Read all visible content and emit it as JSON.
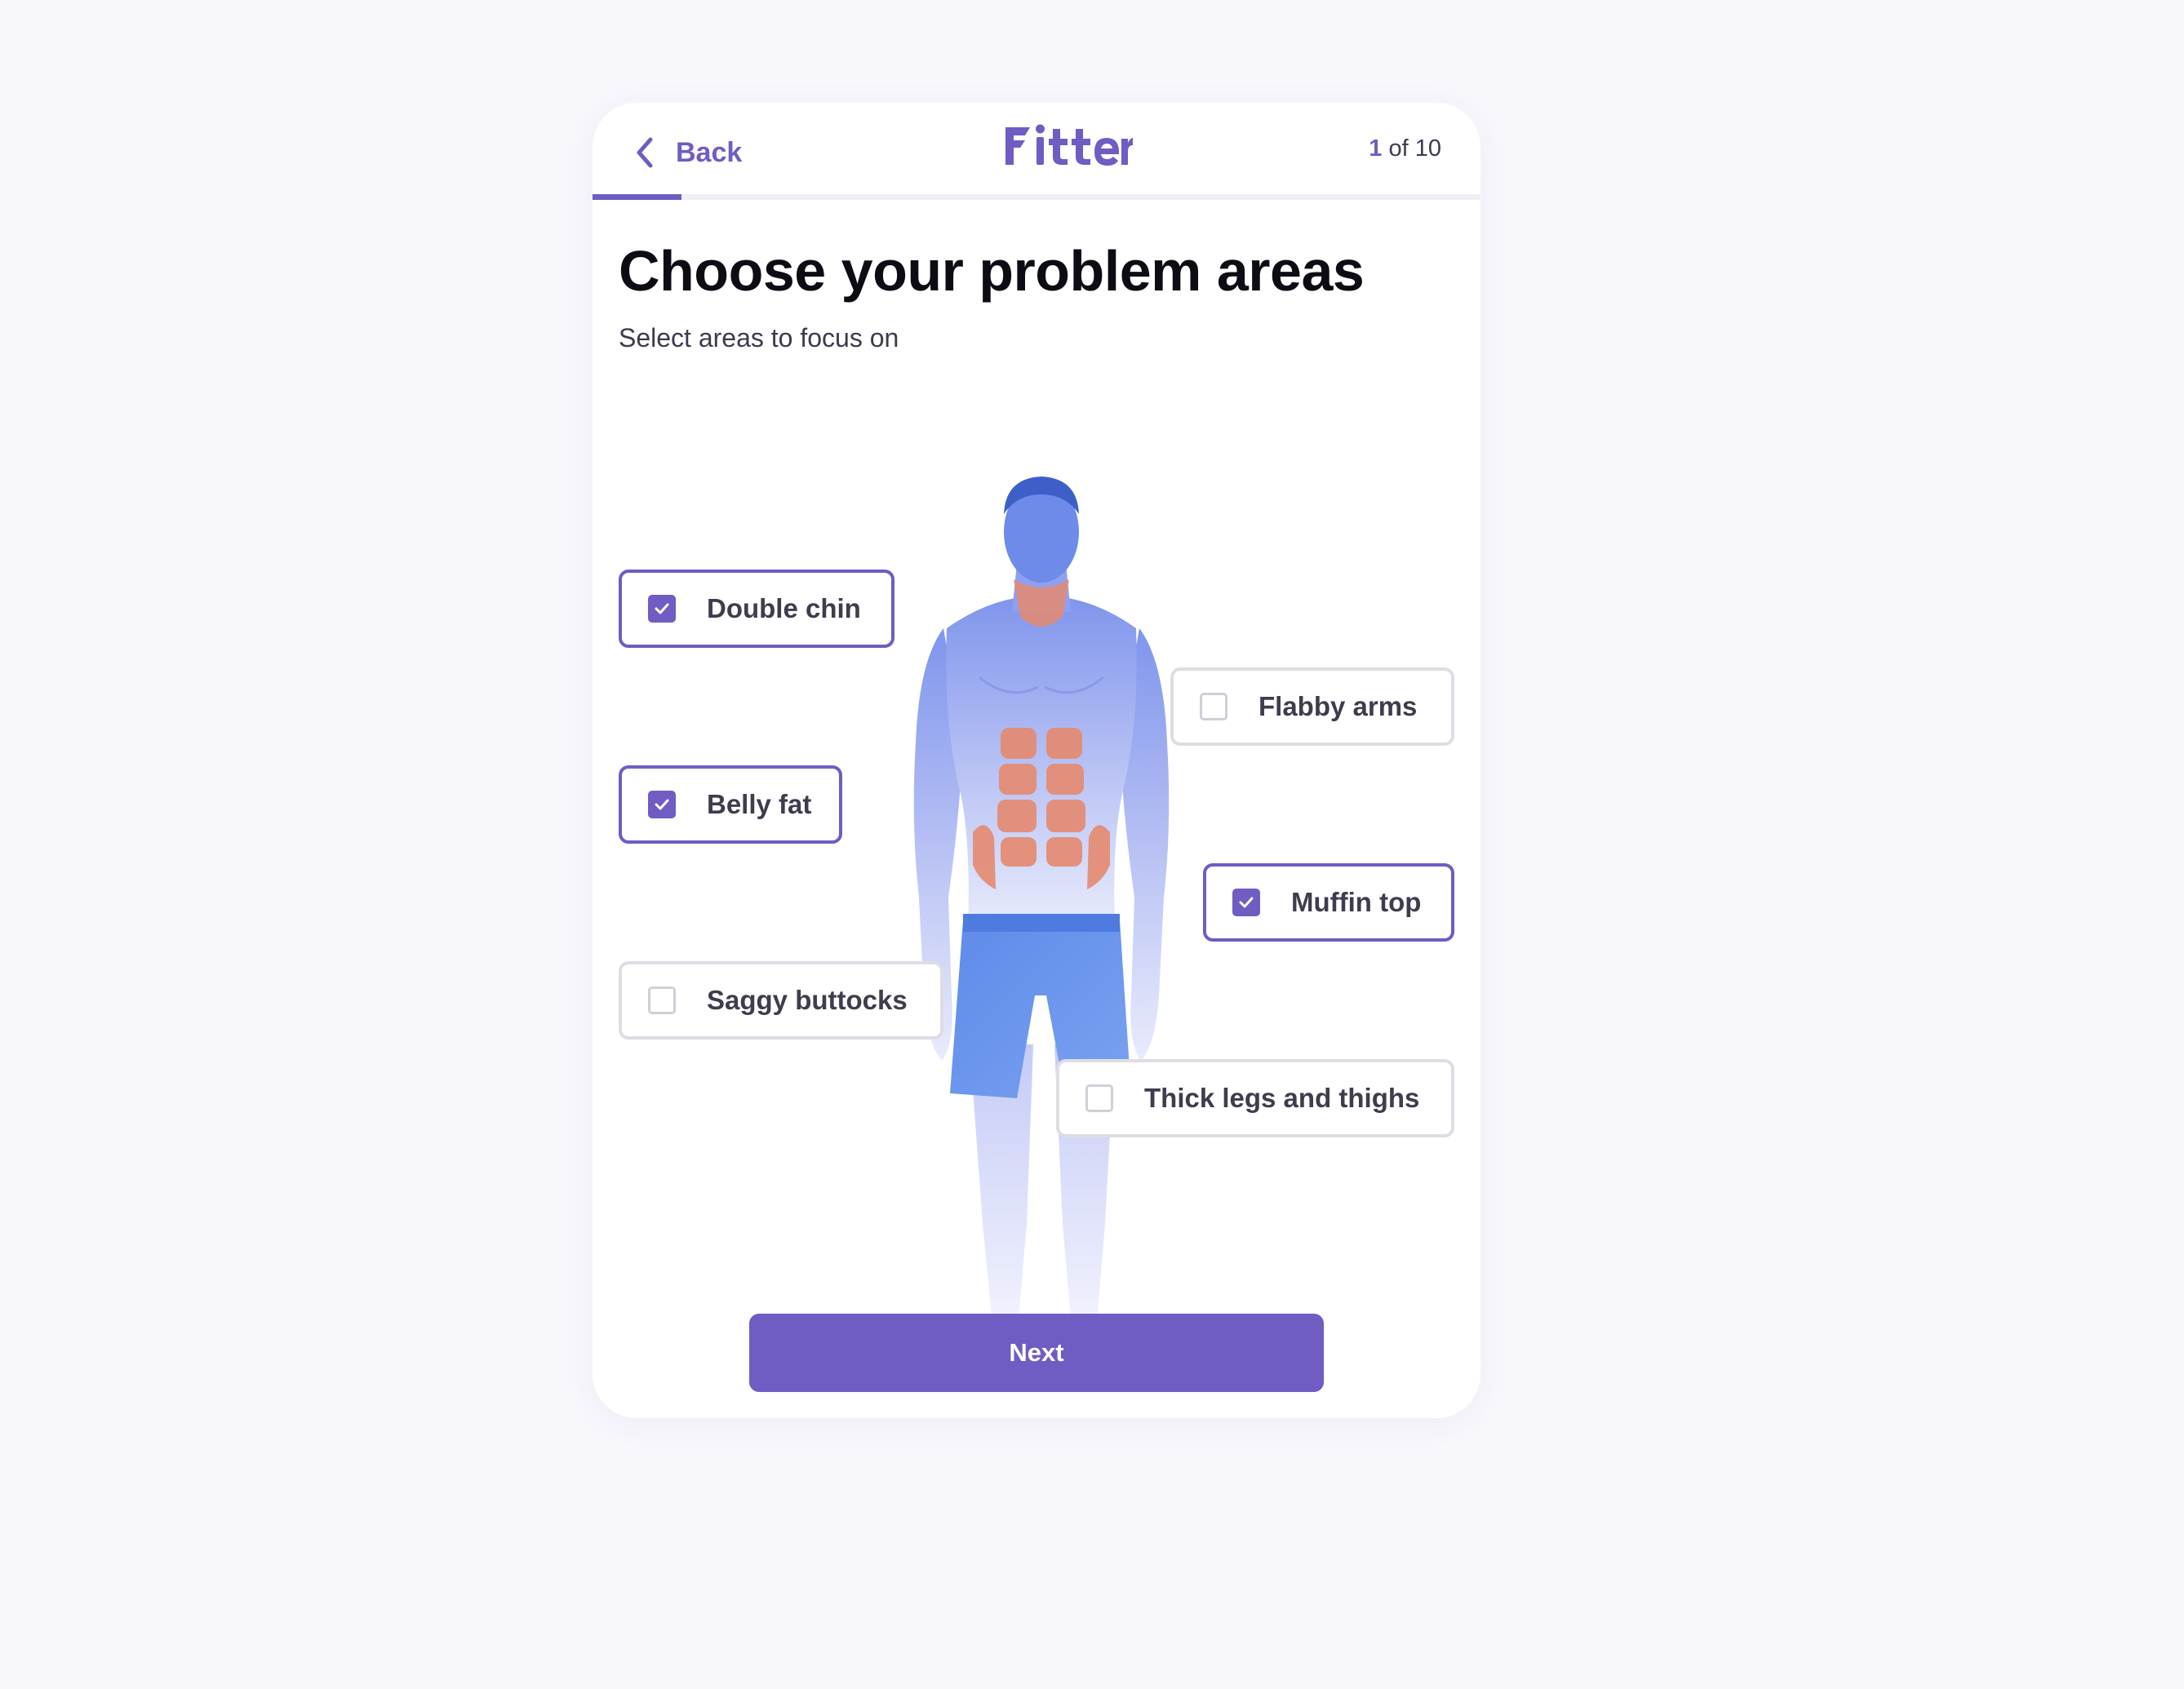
{
  "header": {
    "back_label": "Back",
    "logo_text": "Fitter",
    "step_current": "1",
    "step_rest": " of 10",
    "progress_fraction": 0.1
  },
  "title": "Choose your problem areas",
  "subtitle": "Select areas to focus on",
  "options": [
    {
      "label": "Double chin",
      "checked": true
    },
    {
      "label": "Flabby arms",
      "checked": false
    },
    {
      "label": "Belly fat",
      "checked": true
    },
    {
      "label": "Muffin top",
      "checked": true
    },
    {
      "label": "Saggy buttocks",
      "checked": false
    },
    {
      "label": "Thick legs and thighs",
      "checked": false
    }
  ],
  "next_label": "Next",
  "colors": {
    "accent": "#705cc3",
    "background": "#f8f7fc",
    "card": "#ffffff",
    "muscle_highlight": "#e58a70",
    "figure_tint": "#5b86ea"
  }
}
